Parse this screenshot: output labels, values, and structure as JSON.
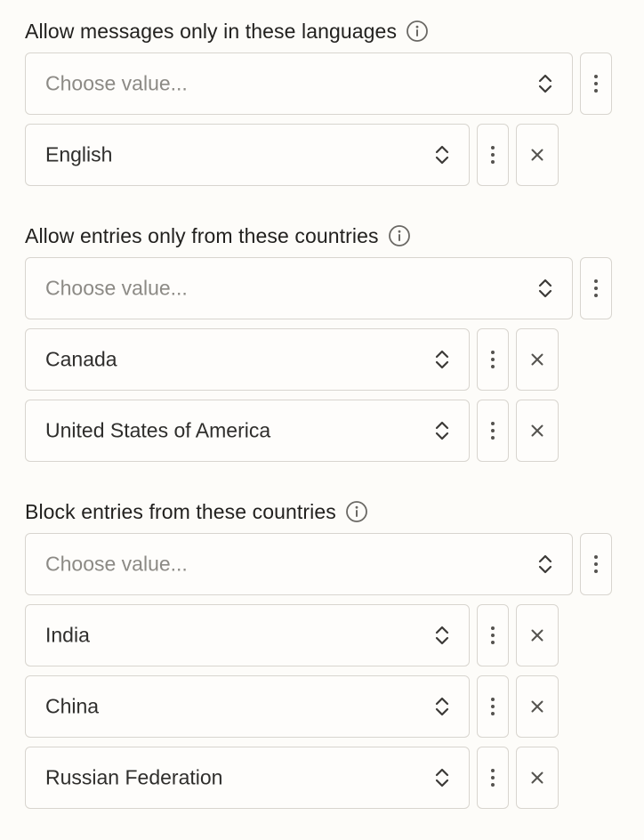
{
  "sections": [
    {
      "label": "Allow messages only in these languages",
      "placeholder": "Choose value...",
      "items": [
        "English"
      ]
    },
    {
      "label": "Allow entries only from these countries",
      "placeholder": "Choose value...",
      "items": [
        "Canada",
        "United States of America"
      ]
    },
    {
      "label": "Block entries from these countries",
      "placeholder": "Choose value...",
      "items": [
        "India",
        "China",
        "Russian Federation"
      ]
    }
  ],
  "icons": {
    "info": "info-circle-icon",
    "chevron": "chevron-up-down-icon",
    "kebab": "vertical-dots-icon",
    "remove": "close-x-icon"
  },
  "colors": {
    "background": "#fdfcf9",
    "border": "#d8d5cf",
    "text": "#2b2a28",
    "placeholder": "#8c8a85"
  }
}
